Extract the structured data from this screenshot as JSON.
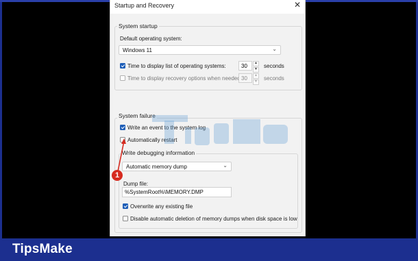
{
  "brand": "TipsMake",
  "dialog": {
    "title": "Startup and Recovery",
    "close_glyph": "✕"
  },
  "system_startup": {
    "label": "System startup",
    "default_os_label": "Default operating system:",
    "default_os_value": "Windows 11",
    "show_os_list": {
      "label": "Time to display list of operating systems:",
      "checked": true,
      "value": "30",
      "unit": "seconds"
    },
    "show_recovery": {
      "label": "Time to display recovery options when needed:",
      "checked": false,
      "value": "30",
      "unit": "seconds"
    }
  },
  "system_failure": {
    "label": "System failure",
    "write_event": {
      "label": "Write an event to the system log",
      "checked": true
    },
    "auto_restart": {
      "label": "Automatically restart",
      "checked": false
    },
    "debug_label": "Write debugging information",
    "debug_value": "Automatic memory dump",
    "dump_file_label": "Dump file:",
    "dump_file_value": "%SystemRoot%\\MEMORY.DMP",
    "overwrite": {
      "label": "Overwrite any existing file",
      "checked": true
    },
    "disable_auto_delete": {
      "label": "Disable automatic deletion of memory dumps when disk space is low",
      "checked": false
    }
  },
  "annotation": {
    "step": "1"
  },
  "colors": {
    "brand_blue": "#1c2f8f",
    "accent": "#1f5fb8",
    "badge_red": "#d62b20"
  }
}
